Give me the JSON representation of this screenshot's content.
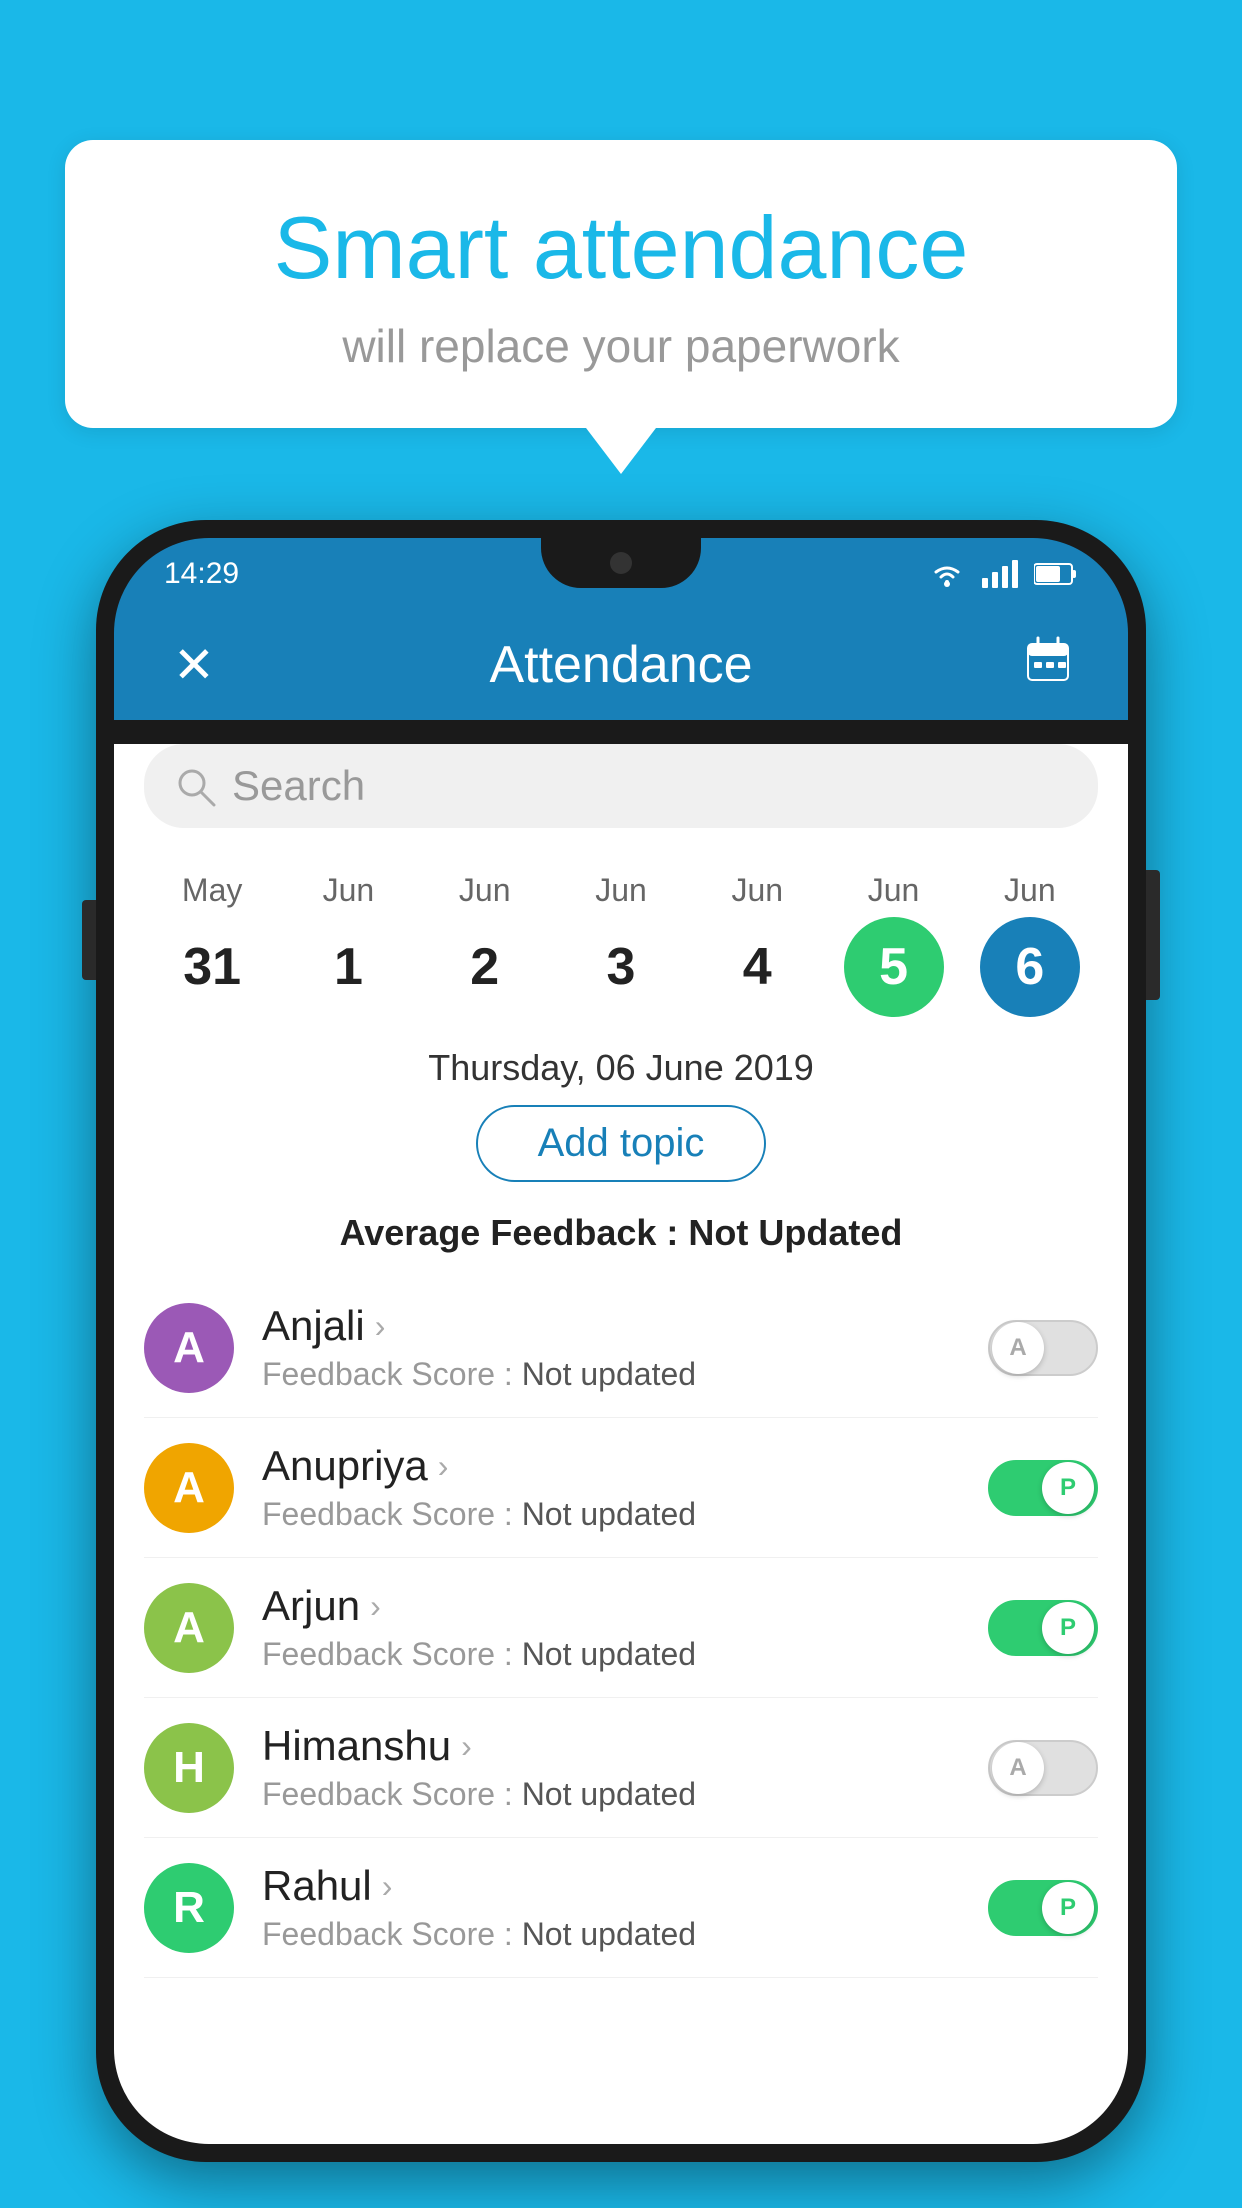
{
  "background_color": "#1ab8e8",
  "bubble": {
    "title": "Smart attendance",
    "subtitle": "will replace your paperwork"
  },
  "status_bar": {
    "time": "14:29"
  },
  "app_bar": {
    "title": "Attendance",
    "close_label": "×",
    "calendar_label": "📅"
  },
  "search": {
    "placeholder": "Search"
  },
  "calendar": {
    "days": [
      {
        "month": "May",
        "date": "31",
        "style": "normal"
      },
      {
        "month": "Jun",
        "date": "1",
        "style": "normal"
      },
      {
        "month": "Jun",
        "date": "2",
        "style": "normal"
      },
      {
        "month": "Jun",
        "date": "3",
        "style": "normal"
      },
      {
        "month": "Jun",
        "date": "4",
        "style": "normal"
      },
      {
        "month": "Jun",
        "date": "5",
        "style": "today"
      },
      {
        "month": "Jun",
        "date": "6",
        "style": "selected"
      }
    ]
  },
  "selected_date": "Thursday, 06 June 2019",
  "add_topic_label": "Add topic",
  "avg_feedback_label": "Average Feedback :",
  "avg_feedback_value": "Not Updated",
  "students": [
    {
      "name": "Anjali",
      "initial": "A",
      "avatar_color": "#9b59b6",
      "feedback_label": "Feedback Score :",
      "feedback_value": "Not updated",
      "toggle": "off",
      "toggle_letter": "A"
    },
    {
      "name": "Anupriya",
      "initial": "A",
      "avatar_color": "#f0a500",
      "feedback_label": "Feedback Score :",
      "feedback_value": "Not updated",
      "toggle": "on",
      "toggle_letter": "P"
    },
    {
      "name": "Arjun",
      "initial": "A",
      "avatar_color": "#8bc34a",
      "feedback_label": "Feedback Score :",
      "feedback_value": "Not updated",
      "toggle": "on",
      "toggle_letter": "P"
    },
    {
      "name": "Himanshu",
      "initial": "H",
      "avatar_color": "#8bc34a",
      "feedback_label": "Feedback Score :",
      "feedback_value": "Not updated",
      "toggle": "off",
      "toggle_letter": "A"
    },
    {
      "name": "Rahul",
      "initial": "R",
      "avatar_color": "#2ecc71",
      "feedback_label": "Feedback Score :",
      "feedback_value": "Not updated",
      "toggle": "on",
      "toggle_letter": "P"
    }
  ]
}
